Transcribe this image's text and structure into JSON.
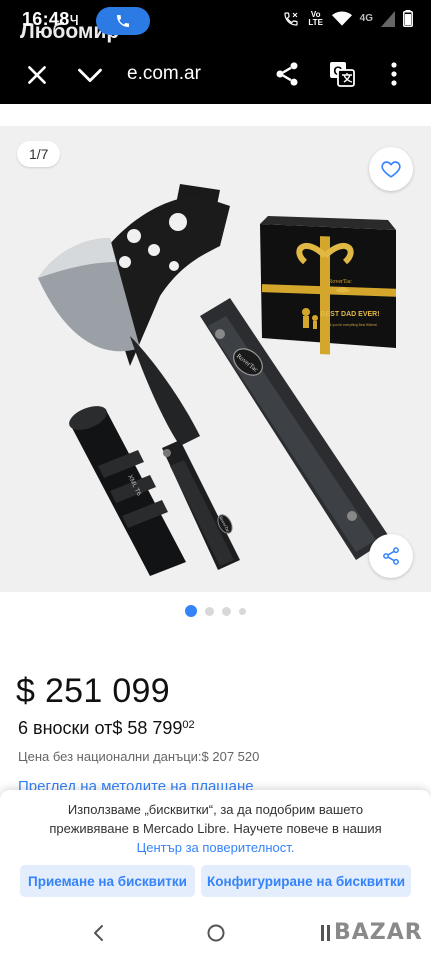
{
  "status_bar": {
    "time": "16:48",
    "time_suffix": "ч",
    "contact_name": "Любомир",
    "network": "4G",
    "volte": "Vo LTE"
  },
  "toolbar": {
    "url": "e.com.ar",
    "icons": [
      "close-icon",
      "chevron-down-icon",
      "share-icon",
      "translate-icon",
      "more-vert-icon"
    ]
  },
  "gallery": {
    "counter": "1/7",
    "box_brand": "RoverTac",
    "box_headline": "BEST DAD EVER!",
    "box_subline": "Thank you for everything Best Wishes!",
    "tool_brand": "RoverTac",
    "knife_brand": "RoverTac",
    "flashlight_label": "XML T6",
    "dots": 4,
    "active_dot": 0
  },
  "product": {
    "price": "$ 251 099",
    "installments_prefix": "6 вноски от",
    "installment_amount": "$ 58 799",
    "installment_cents": "02",
    "no_tax_label": "Цена без национални данъци:",
    "no_tax_value": "$ 207 520",
    "payment_methods_link": "Преглед на методите на плащане"
  },
  "cookie_banner": {
    "text": "Използваме „бисквитки“, за да подобрим вашето преживяване в Mercado Libre. Научете повече в нашия",
    "link": "Център за поверителност.",
    "accept_label": "Приемане на бисквитки",
    "configure_label": "Конфигуриране на бисквитки"
  },
  "navbar": {
    "watermark": "BAZAR"
  },
  "colors": {
    "accent": "#3483fa",
    "accent_light": "#e3edfb",
    "topbar": "#000000",
    "call_pill": "#2c7be5"
  }
}
